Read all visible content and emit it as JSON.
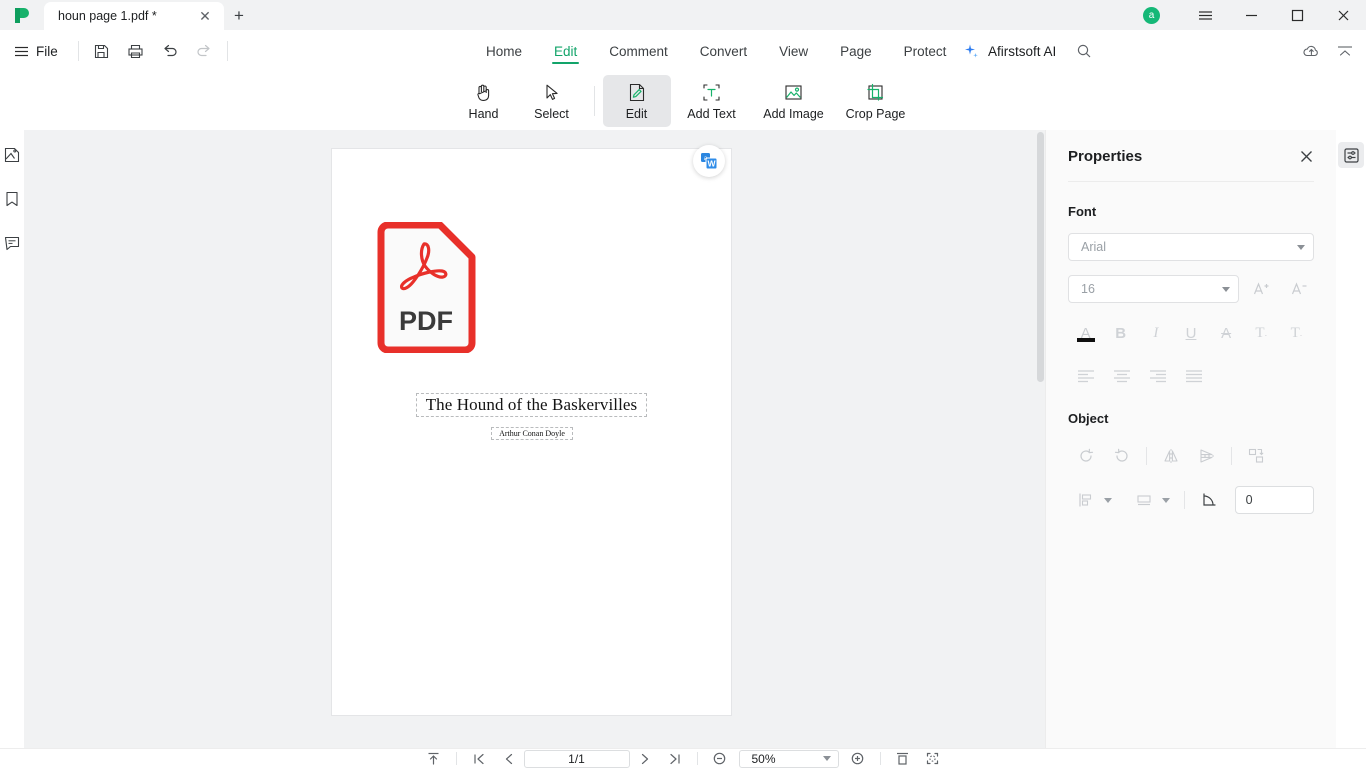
{
  "window": {
    "app_logo": "afirstsoft-logo-icon",
    "avatar_letter": "a",
    "menu_icon": "hamburger-menu-icon",
    "minimize_icon": "minimize-icon",
    "maximize_icon": "maximize-icon",
    "close_icon": "close-icon"
  },
  "tabs": {
    "items": [
      {
        "title": "houn page 1.pdf *",
        "close_icon": "close-icon"
      }
    ],
    "new_tab_label": "+"
  },
  "menubar": {
    "file_label": "File",
    "file_icon": "hamburger-menu-icon",
    "quick_actions": [
      {
        "name": "save-icon"
      },
      {
        "name": "print-icon"
      },
      {
        "name": "undo-icon"
      },
      {
        "name": "redo-icon"
      }
    ],
    "ribbon_tabs": [
      {
        "label": "Home",
        "active": false
      },
      {
        "label": "Edit",
        "active": true
      },
      {
        "label": "Comment",
        "active": false
      },
      {
        "label": "Convert",
        "active": false
      },
      {
        "label": "View",
        "active": false
      },
      {
        "label": "Page",
        "active": false
      },
      {
        "label": "Protect",
        "active": false
      }
    ],
    "ai_label": "Afirstsoft AI",
    "ai_icon": "sparkle-icon",
    "search_icon": "search-icon",
    "cloud_icon": "cloud-upload-icon",
    "collapse_icon": "collapse-ribbon-icon",
    "accent_color": "#12a46a"
  },
  "toolbar": {
    "tools": [
      {
        "label": "Hand",
        "icon": "hand-icon",
        "active": false
      },
      {
        "label": "Select",
        "icon": "cursor-arrow-icon",
        "active": false
      },
      {
        "label": "Edit",
        "icon": "edit-pencil-page-icon",
        "active": true
      },
      {
        "label": "Add Text",
        "icon": "add-text-icon",
        "active": false
      },
      {
        "label": "Add Image",
        "icon": "add-image-icon",
        "active": false
      },
      {
        "label": "Crop Page",
        "icon": "crop-page-icon",
        "active": false
      }
    ]
  },
  "left_rail": {
    "items": [
      {
        "name": "thumbnails-icon"
      },
      {
        "name": "bookmark-icon"
      },
      {
        "name": "comment-icon"
      }
    ]
  },
  "document": {
    "pdf_badge_label": "PDF",
    "pdf_badge_icon": "adobe-pdf-icon",
    "title": "The Hound of the Baskervilles",
    "author": "Arthur Conan Doyle",
    "convert_fab_icon": "convert-to-word-icon",
    "background_color": "#f1f2f3",
    "page_color": "#ffffff"
  },
  "properties": {
    "title": "Properties",
    "close_icon": "close-icon",
    "font_section": {
      "title": "Font",
      "family_value": "Arial",
      "family_caret_icon": "chevron-down-icon",
      "size_value": "16",
      "size_caret_icon": "chevron-down-icon",
      "increase_icon": "increase-font-size-icon",
      "decrease_icon": "decrease-font-size-icon",
      "format_icons": [
        {
          "name": "font-color-icon",
          "glyph": "A"
        },
        {
          "name": "bold-icon",
          "glyph": "B"
        },
        {
          "name": "italic-icon",
          "glyph": "I"
        },
        {
          "name": "underline-icon",
          "glyph": "U"
        },
        {
          "name": "strikethrough-icon",
          "glyph": "A"
        },
        {
          "name": "superscript-icon",
          "glyph": "T"
        },
        {
          "name": "subscript-icon",
          "glyph": "T"
        }
      ],
      "align_icons": [
        {
          "name": "align-left-icon"
        },
        {
          "name": "align-center-icon"
        },
        {
          "name": "align-right-icon"
        },
        {
          "name": "align-justify-icon"
        }
      ]
    },
    "object_section": {
      "title": "Object",
      "transform_icons": [
        {
          "name": "rotate-left-icon"
        },
        {
          "name": "rotate-right-icon"
        },
        {
          "name": "flip-horizontal-icon"
        },
        {
          "name": "flip-vertical-icon"
        },
        {
          "name": "arrange-order-icon"
        }
      ],
      "align_dropdown_icon": "align-objects-icon",
      "distribute_dropdown_icon": "distribute-objects-icon",
      "angle_icon": "angle-icon",
      "angle_value": "0"
    }
  },
  "right_rail": {
    "properties_toggle_icon": "properties-panel-icon"
  },
  "statusbar": {
    "scroll_top_icon": "scroll-to-top-icon",
    "first_page_icon": "first-page-icon",
    "prev_page_icon": "previous-page-icon",
    "page_value": "1/1",
    "next_page_icon": "next-page-icon",
    "last_page_icon": "last-page-icon",
    "zoom_out_icon": "zoom-out-icon",
    "zoom_value": "50%",
    "zoom_caret_icon": "chevron-down-icon",
    "zoom_in_icon": "zoom-in-icon",
    "fit_page_icon": "fit-page-icon",
    "fit_width_icon": "fit-width-icon"
  }
}
